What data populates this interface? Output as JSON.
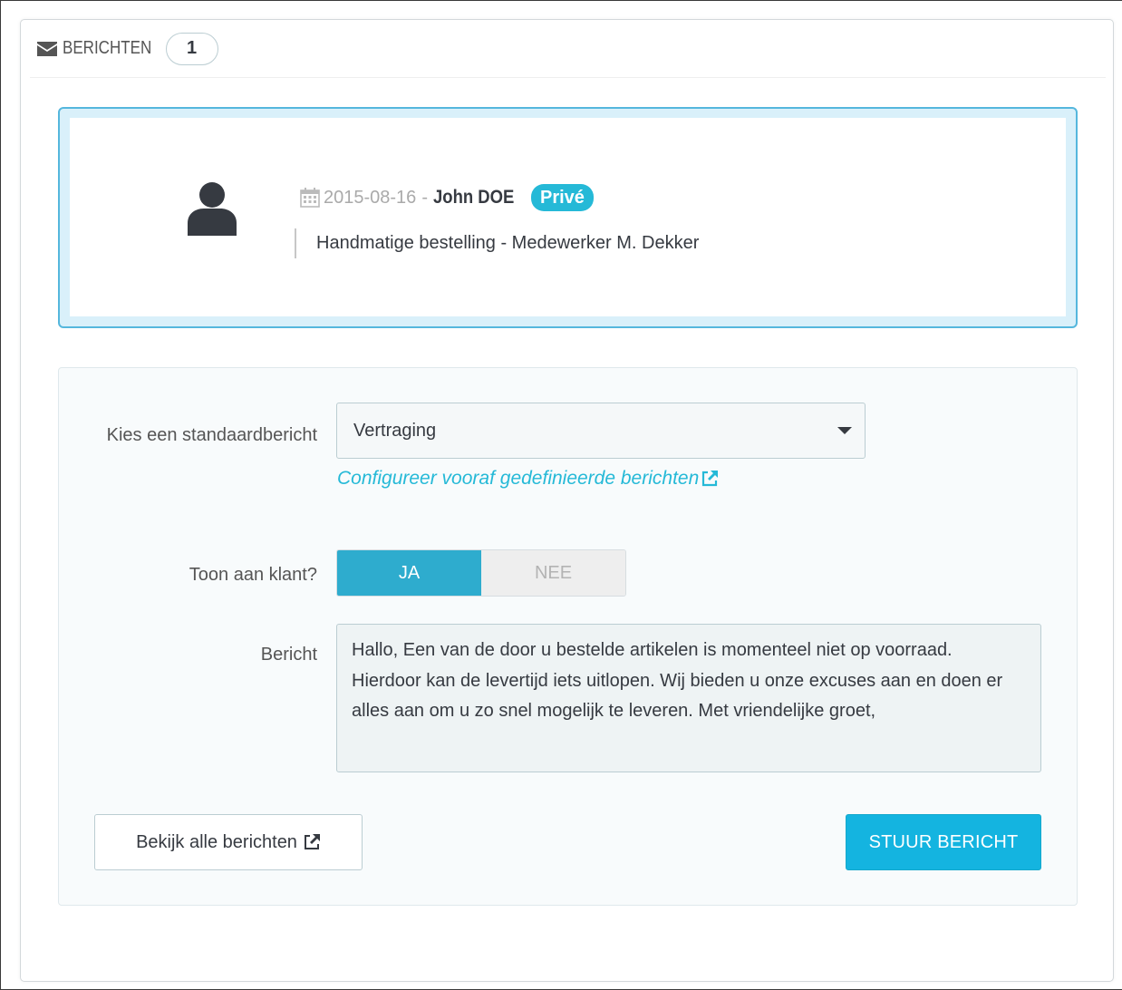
{
  "header": {
    "title": "BERICHTEN",
    "count": "1",
    "icon": "envelope-icon"
  },
  "message": {
    "date": "2015-08-16",
    "separator": "-",
    "author": "John DOE",
    "private_badge": "Privé",
    "text": "Handmatige bestelling - Medewerker M. Dekker",
    "avatar_icon": "user-icon",
    "calendar_icon": "calendar-icon"
  },
  "form": {
    "template_label": "Kies een standaardbericht",
    "template_value": "Vertraging",
    "config_link": "Configureer vooraf gedefinieerde berichten",
    "show_label": "Toon aan klant?",
    "toggle_yes": "JA",
    "toggle_no": "NEE",
    "toggle_selected": "JA",
    "message_label": "Bericht",
    "message_value": "Hallo, Een van de door u bestelde artikelen is momenteel niet op voorraad. Hierdoor kan de levertijd iets uitlopen. Wij bieden u onze excuses aan en doen er alles aan om u zo snel mogelijk te leveren. Met vriendelijke groet,"
  },
  "actions": {
    "view_all": "Bekijk alle berichten",
    "send": "STUUR BERICHT"
  },
  "colors": {
    "accent": "#25b9d7",
    "toggle_active": "#2eacce",
    "send_button": "#14b4e0",
    "message_border": "#55b7dd",
    "message_bg": "#d9f0fa"
  }
}
